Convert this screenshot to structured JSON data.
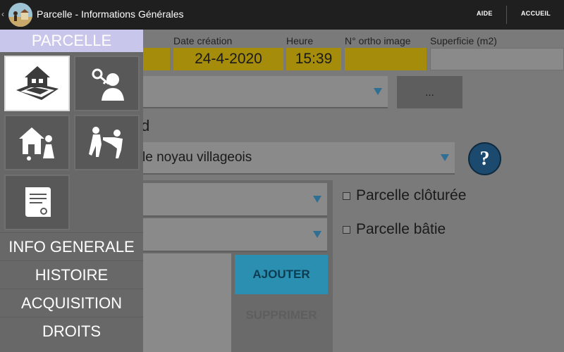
{
  "appbar": {
    "back_glyph": "‹",
    "title": "Parcelle - Informations Générales",
    "aide": "AIDE",
    "accueil": "ACCUEIL"
  },
  "form": {
    "labels": {
      "date": "Date création",
      "heure": "Heure",
      "ortho": "N° ortho image",
      "superficie": "Superficie (m2)"
    },
    "date_value": "24-4-2020",
    "heure_value": "15:39",
    "ortho_value": "",
    "superficie_value": "",
    "ellipsis_button": "...",
    "section_label_fragment": "d",
    "zone_value": "le noyau villageois",
    "help_glyph": "?",
    "checkbox_cloturee": "Parcelle clôturée",
    "checkbox_batie": "Parcelle bâtie",
    "ajouter": "AJOUTER",
    "supprimer": "SUPPRIMER"
  },
  "drawer": {
    "header": "PARCELLE",
    "tiles": [
      {
        "icon": "house-parcel-icon",
        "active": true
      },
      {
        "icon": "owner-key-icon",
        "active": false
      },
      {
        "icon": "house-family-icon",
        "active": false
      },
      {
        "icon": "conflict-icon",
        "active": false
      },
      {
        "icon": "certificate-icon",
        "active": false
      }
    ],
    "menu": [
      "INFO GENERALE",
      "HISTOIRE",
      "ACQUISITION",
      "DROITS"
    ]
  },
  "colors": {
    "appbar": "#1f1f1f",
    "drawer_header": "#c9c6ec",
    "yellow_field": "#a58c0a",
    "ajouter_button": "#2a8fb0",
    "spinner_arrow": "#2e6f93"
  }
}
